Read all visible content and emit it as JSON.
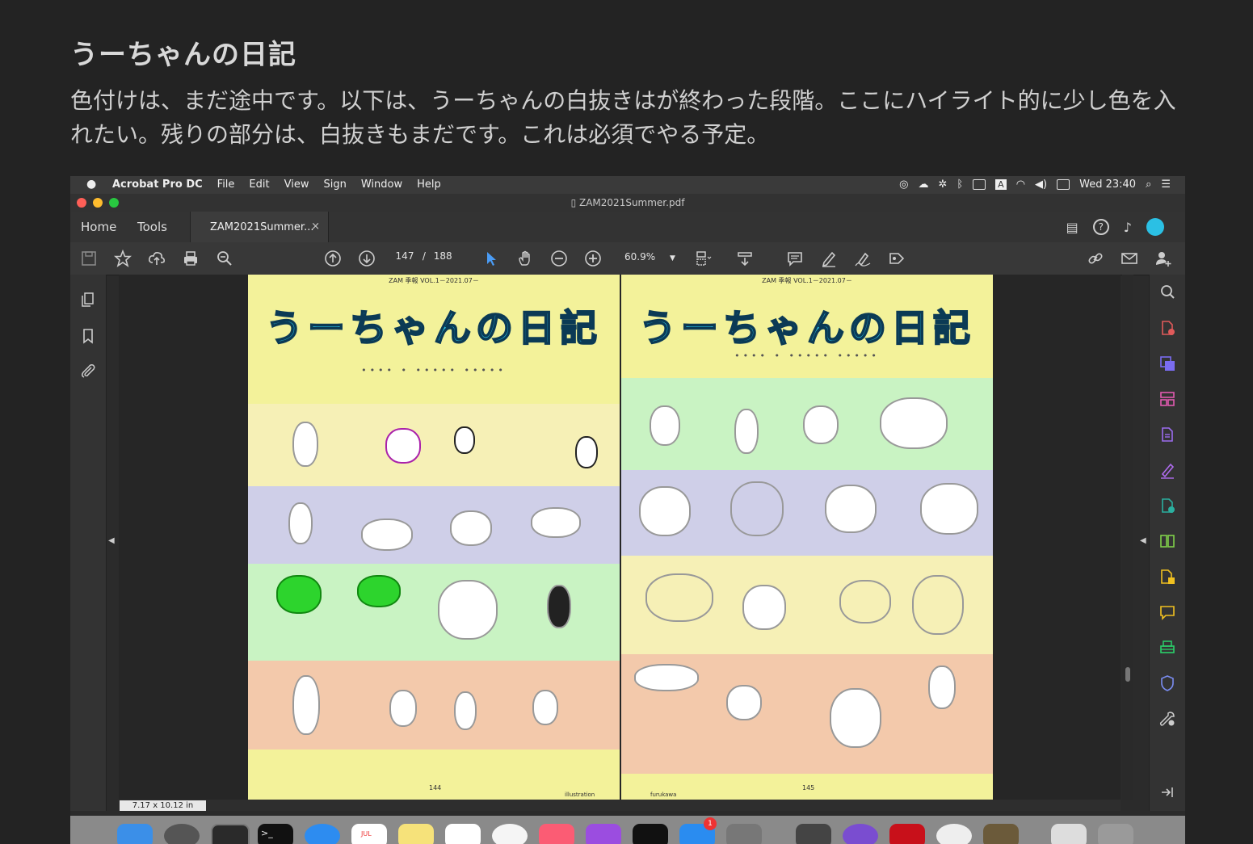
{
  "blog": {
    "title": "うーちゃんの日記",
    "paragraph": "色付けは、まだ途中です。以下は、うーちゃんの白抜きはが終わった段階。ここにハイライト的に少し色を入れたい。残りの部分は、白抜きもまだです。これは必須でやる予定。"
  },
  "menubar": {
    "app": "Acrobat Pro DC",
    "items": [
      "File",
      "Edit",
      "View",
      "Sign",
      "Window",
      "Help"
    ],
    "input_indicator": "A",
    "clock": "Wed 23:40"
  },
  "window": {
    "title": "ZAM2021Summer.pdf"
  },
  "tabs": {
    "home": "Home",
    "tools": "Tools",
    "document": "ZAM2021Summer...",
    "close": "×"
  },
  "toolbar": {
    "current_page": "147",
    "page_separator": "/",
    "total_pages": "188",
    "zoom": "60.9%"
  },
  "status": {
    "page_size": "7.17 x 10.12 in"
  },
  "pages": [
    {
      "header": "ZAM 季報 VOL.1－2021.07－",
      "title": "うーちゃんの日記",
      "number": "144",
      "footer": "illustration",
      "bands": [
        "#f6f0b6",
        "#cfcfe8",
        "#c9f3c3",
        "#f3c9ab"
      ]
    },
    {
      "header": "ZAM 季報 VOL.1－2021.07－",
      "title": "うーちゃんの日記",
      "number": "145",
      "footer": "furukawa",
      "bands": [
        "#c9f3c3",
        "#cfcfe8",
        "#f6f0b6",
        "#f3c9ab"
      ]
    }
  ],
  "colors": {
    "title_cyan": "#2bc0e4",
    "right_rail_icons": [
      "#e05a5a",
      "#7a6cf0",
      "#e05ab0",
      "#9c6cf0",
      "#b06cf0",
      "#2bb0a0",
      "#7fd04a",
      "#f0c020",
      "#f0c020",
      "#2bd06a",
      "#7a8cf0"
    ]
  },
  "dock": {
    "calendar_month": "JUL",
    "badge": "1"
  }
}
